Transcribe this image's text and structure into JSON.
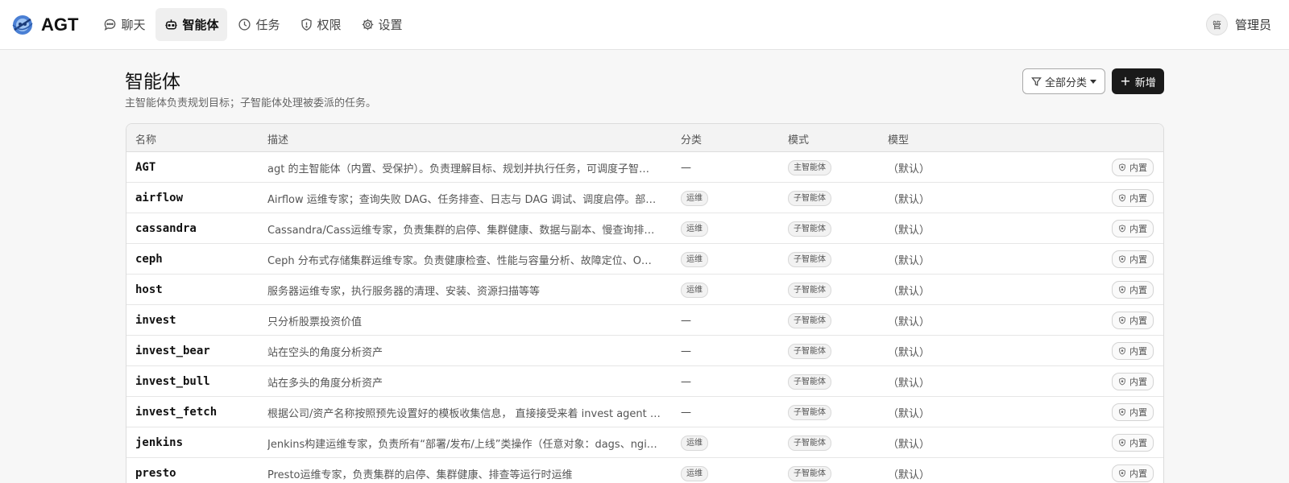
{
  "app": {
    "name": "AGT"
  },
  "nav": [
    {
      "label": "聊天",
      "icon": "chat-icon"
    },
    {
      "label": "智能体",
      "icon": "robot-icon",
      "active": true
    },
    {
      "label": "任务",
      "icon": "clock-icon"
    },
    {
      "label": "权限",
      "icon": "shield-icon"
    },
    {
      "label": "设置",
      "icon": "gear-icon"
    }
  ],
  "user": {
    "avatar_text": "管",
    "name": "管理员"
  },
  "page": {
    "title": "智能体",
    "subtitle": "主智能体负责规划目标；子智能体处理被委派的任务。",
    "filter_label": "全部分类",
    "add_label": "新增"
  },
  "table": {
    "headers": {
      "name": "名称",
      "desc": "描述",
      "category": "分类",
      "mode": "模式",
      "model": "模型"
    },
    "rows": [
      {
        "name": "AGT",
        "desc": "agt 的主智能体（内置、受保护）。负责理解目标、规划并执行任务，可调度子智…",
        "category": "—",
        "category_tag": false,
        "mode": "主智能体",
        "model": "（默认）",
        "builtin": "内置"
      },
      {
        "name": "airflow",
        "desc": "Airflow 运维专家；查询失败 DAG、任务排查、日志与 DAG 调试、调度启停。部…",
        "category": "运维",
        "category_tag": true,
        "mode": "子智能体",
        "model": "（默认）",
        "builtin": "内置"
      },
      {
        "name": "cassandra",
        "desc": "Cassandra/Cass运维专家，负责集群的启停、集群健康、数据与副本、慢查询排…",
        "category": "运维",
        "category_tag": true,
        "mode": "子智能体",
        "model": "（默认）",
        "builtin": "内置"
      },
      {
        "name": "ceph",
        "desc": "Ceph 分布式存储集群运维专家。负责健康检查、性能与容量分析、故障定位、O…",
        "category": "运维",
        "category_tag": true,
        "mode": "子智能体",
        "model": "（默认）",
        "builtin": "内置"
      },
      {
        "name": "host",
        "desc": "服务器运维专家，执行服务器的清理、安装、资源扫描等等",
        "category": "运维",
        "category_tag": true,
        "mode": "子智能体",
        "model": "（默认）",
        "builtin": "内置"
      },
      {
        "name": "invest",
        "desc": "只分析股票投资价值",
        "category": "—",
        "category_tag": false,
        "mode": "子智能体",
        "model": "（默认）",
        "builtin": "内置"
      },
      {
        "name": "invest_bear",
        "desc": "站在空头的角度分析资产",
        "category": "—",
        "category_tag": false,
        "mode": "子智能体",
        "model": "（默认）",
        "builtin": "内置"
      },
      {
        "name": "invest_bull",
        "desc": "站在多头的角度分析资产",
        "category": "—",
        "category_tag": false,
        "mode": "子智能体",
        "model": "（默认）",
        "builtin": "内置"
      },
      {
        "name": "invest_fetch",
        "desc": "根据公司/资产名称按照预先设置好的模板收集信息， 直接接受来着 invest agent …",
        "category": "—",
        "category_tag": false,
        "mode": "子智能体",
        "model": "（默认）",
        "builtin": "内置"
      },
      {
        "name": "jenkins",
        "desc": "Jenkins构建运维专家，负责所有“部署/发布/上线”类操作（任意对象：dags、ngi…",
        "category": "运维",
        "category_tag": true,
        "mode": "子智能体",
        "model": "（默认）",
        "builtin": "内置"
      },
      {
        "name": "presto",
        "desc": "Presto运维专家，负责集群的启停、集群健康、排查等运行时运维",
        "category": "运维",
        "category_tag": true,
        "mode": "子智能体",
        "model": "（默认）",
        "builtin": "内置"
      }
    ]
  }
}
